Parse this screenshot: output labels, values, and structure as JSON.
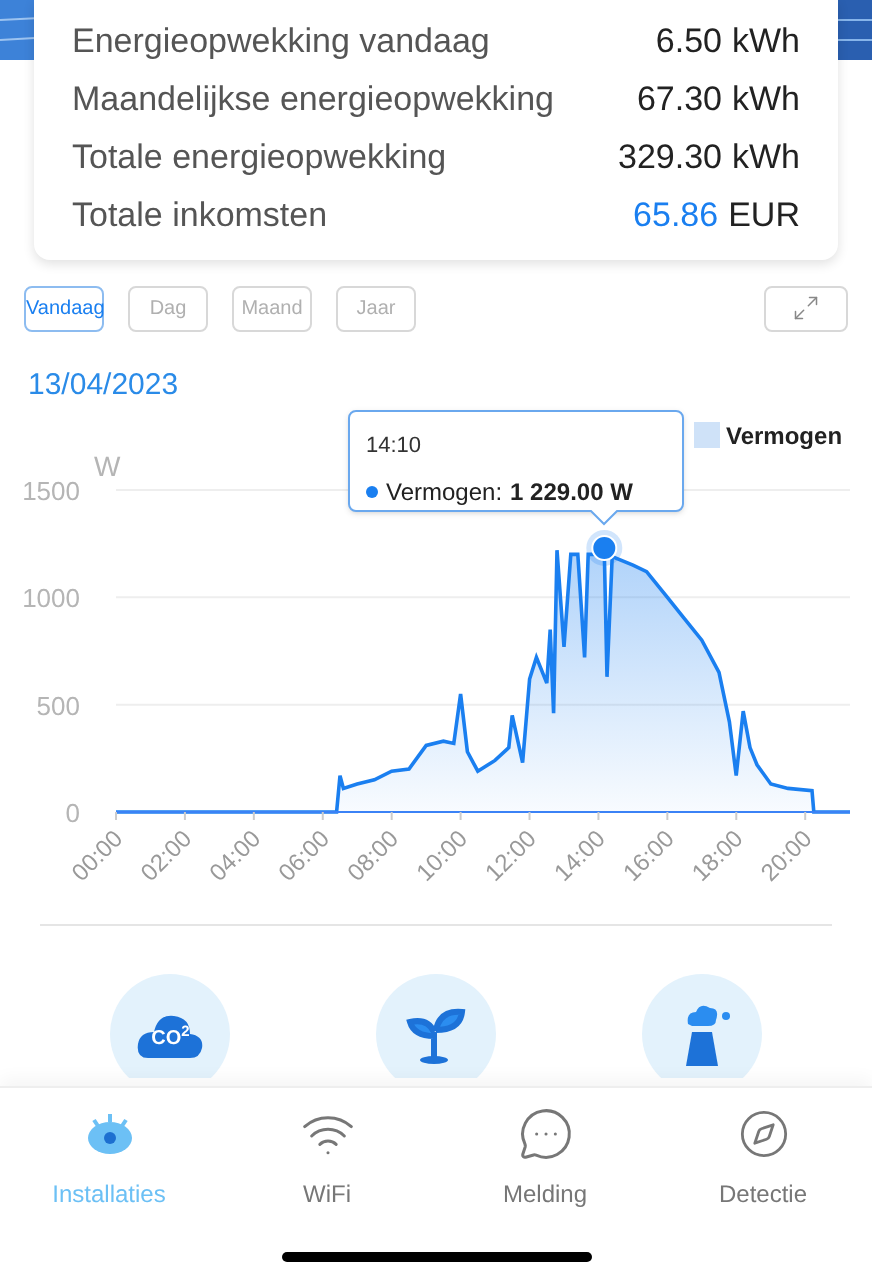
{
  "summary": {
    "rows": [
      {
        "label": "Energieopwekking vandaag",
        "value": "6.50",
        "unit": "kWh",
        "highlight": false
      },
      {
        "label": "Maandelijkse energieopwekking",
        "value": "67.30",
        "unit": "kWh",
        "highlight": false
      },
      {
        "label": "Totale energieopwekking",
        "value": "329.30",
        "unit": "kWh",
        "highlight": false
      },
      {
        "label": "Totale inkomsten",
        "value": "65.86",
        "unit": "EUR",
        "highlight": true
      }
    ]
  },
  "period_tabs": [
    {
      "label": "Vandaag",
      "selected": true
    },
    {
      "label": "Dag",
      "selected": false
    },
    {
      "label": "Maand",
      "selected": false
    },
    {
      "label": "Jaar",
      "selected": false
    }
  ],
  "date": "13/04/2023",
  "chart": {
    "tooltip": {
      "time": "14:10",
      "series": "Vermogen:",
      "value": "1 229.00 W"
    },
    "chart_data": {
      "type": "area",
      "ylabel": "W",
      "x": [
        0,
        6.4,
        6.5,
        6.6,
        7,
        7.5,
        8,
        8.5,
        9,
        9.5,
        9.8,
        10,
        10.2,
        10.5,
        11,
        11.4,
        11.5,
        11.8,
        12,
        12.2,
        12.5,
        12.6,
        12.7,
        12.8,
        13,
        13.2,
        13.4,
        13.6,
        13.7,
        14,
        14.17,
        14.25,
        14.4,
        15,
        15.4,
        16,
        16.5,
        17,
        17.5,
        17.8,
        18,
        18.2,
        18.4,
        18.6,
        19,
        19.5,
        20.2,
        20.25,
        21.3
      ],
      "series": [
        {
          "name": "Vermogen",
          "color": "#1a7ff0",
          "values": [
            0,
            0,
            170,
            110,
            130,
            150,
            190,
            200,
            310,
            330,
            320,
            550,
            280,
            190,
            240,
            300,
            450,
            230,
            620,
            720,
            600,
            850,
            460,
            1220,
            770,
            1200,
            1200,
            720,
            1200,
            1200,
            1230,
            630,
            1190,
            1150,
            1120,
            1000,
            900,
            800,
            650,
            420,
            170,
            470,
            300,
            220,
            130,
            110,
            100,
            0,
            0
          ]
        }
      ],
      "xlim": [
        0,
        21.3
      ],
      "ylim": [
        0,
        1500
      ],
      "xticks": [
        {
          "value": 0,
          "label": "00:00"
        },
        {
          "value": 2,
          "label": "02:00"
        },
        {
          "value": 4,
          "label": "04:00"
        },
        {
          "value": 6,
          "label": "06:00"
        },
        {
          "value": 8,
          "label": "08:00"
        },
        {
          "value": 10,
          "label": "10:00"
        },
        {
          "value": 12,
          "label": "12:00"
        },
        {
          "value": 14,
          "label": "14:00"
        },
        {
          "value": 16,
          "label": "16:00"
        },
        {
          "value": 18,
          "label": "18:00"
        },
        {
          "value": 20,
          "label": "20:00"
        }
      ],
      "yticks": [
        0,
        500,
        1000,
        1500
      ]
    }
  },
  "stats_icons": [
    {
      "kind": "co2",
      "label": "CO$^{2}$"
    },
    {
      "kind": "plant"
    },
    {
      "kind": "factory"
    }
  ],
  "nav": [
    {
      "label": "Installaties",
      "kind": "eye",
      "selected": true
    },
    {
      "label": "WiFi",
      "kind": "wifi",
      "selected": false
    },
    {
      "label": "Melding",
      "kind": "message",
      "selected": false
    },
    {
      "label": "Detectie",
      "kind": "compass",
      "selected": false
    }
  ]
}
